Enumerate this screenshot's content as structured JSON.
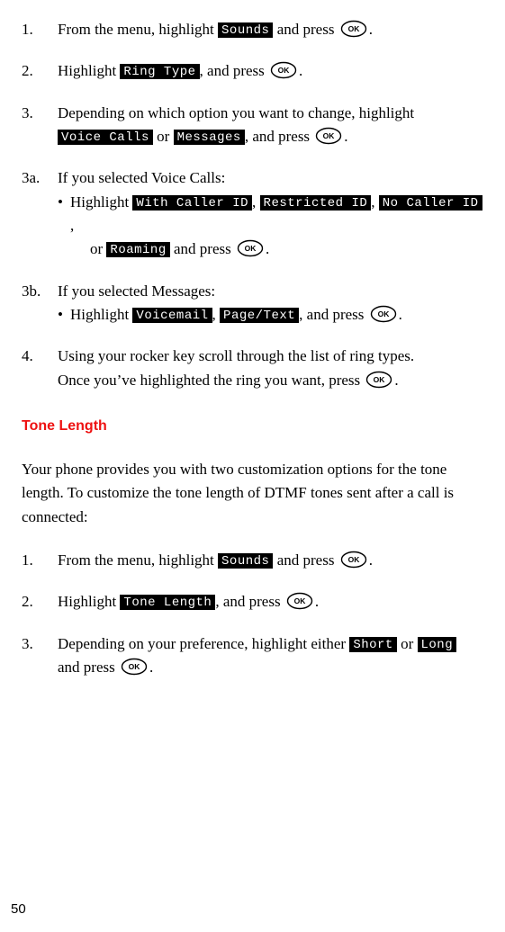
{
  "ok_label": "OK",
  "section1": {
    "s1": {
      "num": "1.",
      "t1": "From the menu, highlight ",
      "chip": "Sounds",
      "t2": " and press ",
      "t3": "."
    },
    "s2": {
      "num": "2.",
      "t1": "Highlight ",
      "chip": "Ring Type",
      "t2": ", and press ",
      "t3": "."
    },
    "s3": {
      "num": "3.",
      "t1": "Depending on which option you want to change, highlight ",
      "chipA": "Voice Calls",
      "or": " or ",
      "chipB": "Messages",
      "t2": ", and press ",
      "t3": "."
    },
    "s3a": {
      "num": "3a.",
      "lead": "If you selected Voice Calls:",
      "bt1": "Highlight ",
      "c1": "With Caller ID",
      "sep1": ", ",
      "c2": "Restricted ID",
      "sep2": ", ",
      "c3": "No Caller ID",
      "sep3": ",",
      "line2a": "or ",
      "c4": "Roaming",
      "line2b": " and press ",
      "line2c": "."
    },
    "s3b": {
      "num": "3b.",
      "lead": "If you selected Messages:",
      "bt1": "Highlight ",
      "c1": "Voicemail",
      "sep1": ", ",
      "c2": "Page/Text",
      "t2": ", and press ",
      "t3": "."
    },
    "s4": {
      "num": "4.",
      "line1": "Using your rocker key scroll through the list of ring types.",
      "line2a": "Once you’ve highlighted the ring you want, press ",
      "line2b": "."
    }
  },
  "heading": "Tone Length",
  "intro": "Your phone provides you with two customization options for the tone length. To customize the tone length of DTMF tones sent after a call is connected:",
  "section2": {
    "s1": {
      "num": "1.",
      "t1": "From the menu, highlight ",
      "chip": "Sounds",
      "t2": " and press ",
      "t3": "."
    },
    "s2": {
      "num": "2.",
      "t1": "Highlight ",
      "chip": "Tone Length",
      "t2": ", and press ",
      "t3": "."
    },
    "s3": {
      "num": "3.",
      "t1": "Depending on your preference, highlight either ",
      "chipA": "Short",
      "or": " or ",
      "chipB": "Long",
      "line2a": "and press ",
      "line2b": "."
    }
  },
  "page_number": "50"
}
